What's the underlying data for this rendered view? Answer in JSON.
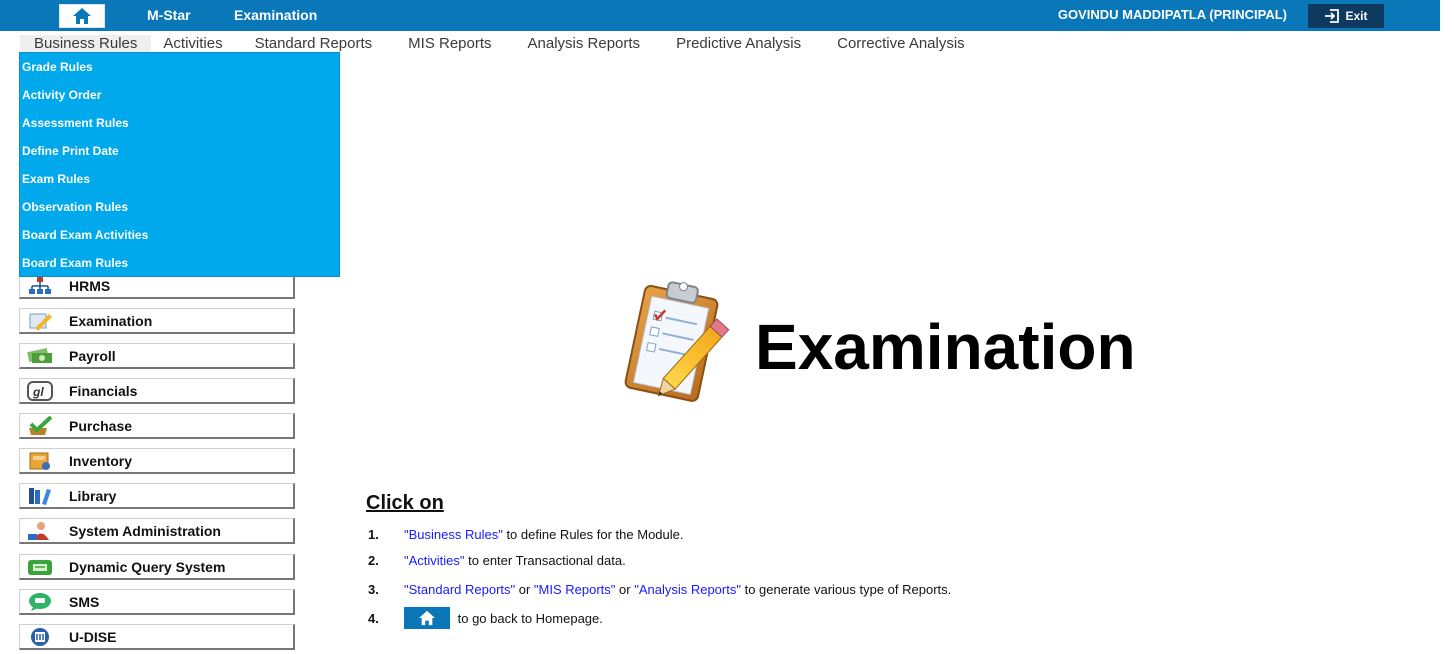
{
  "colors": {
    "topbar": "#0a78b8",
    "dropdown": "#00a9ec",
    "exit_button": "#0d3a5e",
    "link": "#1a1aff"
  },
  "header": {
    "home_icon": "home-icon",
    "app_name": "M-Star",
    "module_name": "Examination",
    "user": "GOVINDU MADDIPATLA (PRINCIPAL)",
    "exit_label": "Exit",
    "exit_icon": "exit-icon"
  },
  "menu": {
    "items": [
      {
        "label": "Business Rules",
        "active": true
      },
      {
        "label": "Activities"
      },
      {
        "label": "Standard Reports"
      },
      {
        "label": "MIS Reports"
      },
      {
        "label": "Analysis Reports"
      },
      {
        "label": "Predictive Analysis"
      },
      {
        "label": "Corrective Analysis"
      }
    ]
  },
  "dropdown": {
    "items": [
      "Grade Rules",
      "Activity Order",
      "Assessment Rules",
      "Define Print Date",
      "Exam Rules",
      "Observation Rules",
      "Board Exam Activities",
      "Board Exam Rules"
    ]
  },
  "modules": [
    {
      "label": "HRMS",
      "icon": "org-chart-icon"
    },
    {
      "label": "Examination",
      "icon": "pencil-paper-icon"
    },
    {
      "label": "Payroll",
      "icon": "money-icon"
    },
    {
      "label": "Financials",
      "icon": "gl-icon"
    },
    {
      "label": "Purchase",
      "icon": "cart-check-icon"
    },
    {
      "label": "Inventory",
      "icon": "inventory-icon"
    },
    {
      "label": "Library",
      "icon": "library-icon"
    },
    {
      "label": "System Administration",
      "icon": "admin-icon"
    },
    {
      "label": "Dynamic Query System",
      "icon": "query-icon"
    },
    {
      "label": "SMS",
      "icon": "sms-icon"
    },
    {
      "label": "U-DISE",
      "icon": "udise-icon"
    }
  ],
  "hero": {
    "icon": "clipboard-pencil-icon",
    "title": "Examination"
  },
  "instructions": {
    "heading": "Click on",
    "steps": [
      {
        "num": "1.",
        "link1": "\"Business Rules\"",
        "text1": " to define Rules for the Module."
      },
      {
        "num": "2.",
        "link1": "\"Activities\"",
        "text1": " to enter Transactional data."
      },
      {
        "num": "3.",
        "link1": "\"Standard Reports\"",
        "text1": " or ",
        "link2": "\"MIS Reports\"",
        "text2": " or ",
        "link3": "\"Analysis Reports\"",
        "text3": " to generate various type of Reports."
      },
      {
        "num": "4.",
        "text1": " to go back to Homepage."
      }
    ]
  }
}
